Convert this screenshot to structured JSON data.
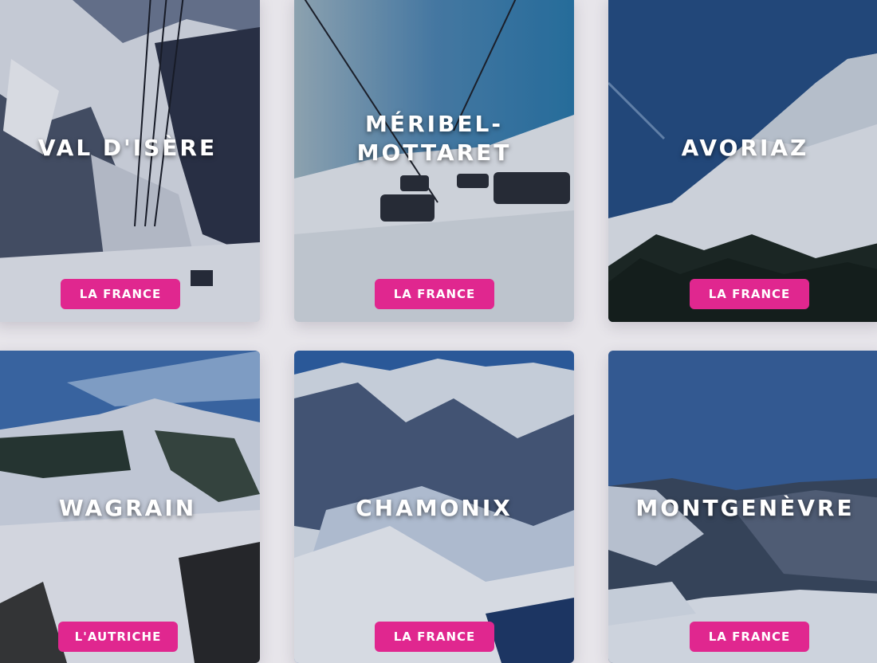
{
  "accent_color": "#e0278f",
  "cards": [
    {
      "name": "VAL D'ISÈRE",
      "country": "LA FRANCE"
    },
    {
      "name_line1": "MÉRIBEL-",
      "name_line2": "MOTTARET",
      "country": "LA FRANCE"
    },
    {
      "name": "AVORIAZ",
      "country": "LA FRANCE"
    },
    {
      "name": "WAGRAIN",
      "country": "L'AUTRICHE"
    },
    {
      "name": "CHAMONIX",
      "country": "LA FRANCE"
    },
    {
      "name": "MONTGENÈVRE",
      "country": "LA FRANCE"
    }
  ]
}
